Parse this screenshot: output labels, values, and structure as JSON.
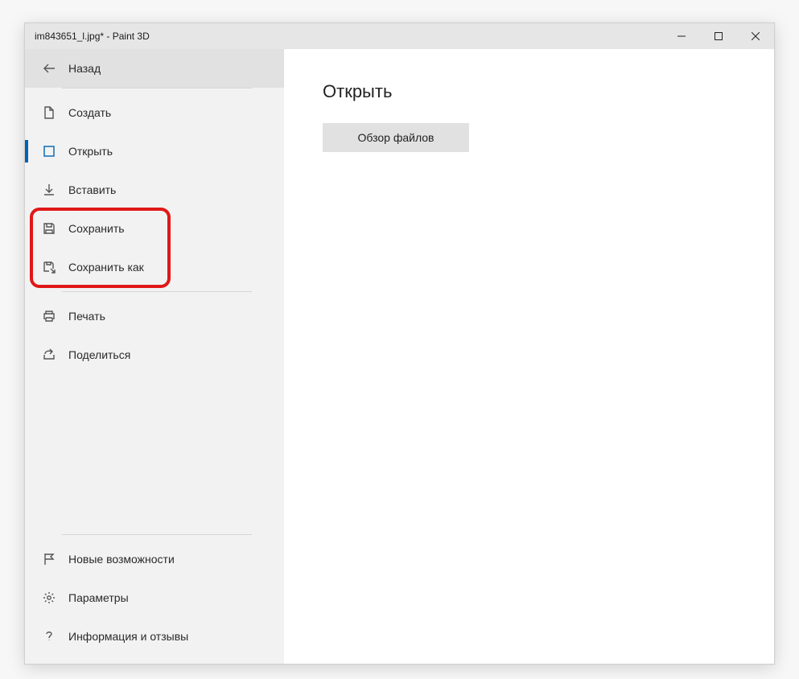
{
  "window": {
    "title": "im843651_l.jpg* - Paint 3D"
  },
  "sidebar": {
    "back_label": "Назад",
    "items": [
      {
        "id": "new",
        "label": "Создать"
      },
      {
        "id": "open",
        "label": "Открыть"
      },
      {
        "id": "insert",
        "label": "Вставить"
      },
      {
        "id": "save",
        "label": "Сохранить"
      },
      {
        "id": "saveas",
        "label": "Сохранить как"
      },
      {
        "id": "print",
        "label": "Печать"
      },
      {
        "id": "share",
        "label": "Поделиться"
      }
    ],
    "bottom_items": [
      {
        "id": "whatsnew",
        "label": "Новые возможности"
      },
      {
        "id": "settings",
        "label": "Параметры"
      },
      {
        "id": "feedback",
        "label": "Информация и отзывы"
      }
    ],
    "active_id": "open",
    "highlighted_ids": [
      "save",
      "saveas"
    ]
  },
  "content": {
    "title": "Открыть",
    "browse_label": "Обзор файлов"
  }
}
